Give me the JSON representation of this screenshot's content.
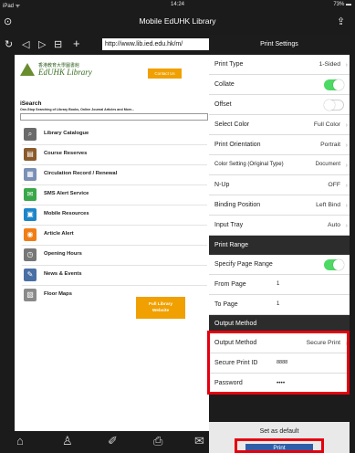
{
  "status": {
    "carrier": "iPad ᯤ",
    "time": "14:24",
    "battery": "73% ▬"
  },
  "window": {
    "title": "Mobile EdUHK Library"
  },
  "browser": {
    "url": "http://www.lib.ied.edu.hk/m/"
  },
  "site": {
    "logo_cn": "香港教育大學圖書館",
    "logo_en": "EdUHK Library",
    "contact_button": "Contact Us",
    "search_title": "iSearch",
    "search_subtitle": "One-Stop Searching of Library Books, Online Journal Articles and More...",
    "menu": [
      {
        "label": "Library Catalogue",
        "icon": "search-icon",
        "color": "#6b6b6b",
        "glyph": "⌕"
      },
      {
        "label": "Course Reserves",
        "icon": "books-icon",
        "color": "#8a5a2b",
        "glyph": "▤"
      },
      {
        "label": "Circulation Record / Renewal",
        "icon": "record-icon",
        "color": "#7a8fb5",
        "glyph": "▦"
      },
      {
        "label": "SMS Alert Service",
        "icon": "sms-icon",
        "color": "#3aa84a",
        "glyph": "✉"
      },
      {
        "label": "Mobile Resources",
        "icon": "mobile-icon",
        "color": "#1d86c8",
        "glyph": "▣"
      },
      {
        "label": "Article Alert",
        "icon": "rss-icon",
        "color": "#f07e16",
        "glyph": "◉"
      },
      {
        "label": "Opening Hours",
        "icon": "clock-icon",
        "color": "#777777",
        "glyph": "◷"
      },
      {
        "label": "News & Events",
        "icon": "news-icon",
        "color": "#4a6fa5",
        "glyph": "✎"
      },
      {
        "label": "Floor Maps",
        "icon": "map-icon",
        "color": "#8a8a8a",
        "glyph": "▧"
      }
    ],
    "full_button_line1": "Full Library",
    "full_button_line2": "Website"
  },
  "print": {
    "title": "Print Settings",
    "rows": [
      {
        "label": "Print Type",
        "value": "1-Sided",
        "chevron": true
      },
      {
        "label": "Collate",
        "toggle": "on"
      },
      {
        "label": "Offset",
        "toggle": "off"
      },
      {
        "label": "Select Color",
        "value": "Full Color",
        "chevron": true
      },
      {
        "label": "Print Orientation",
        "value": "Portrait",
        "chevron": true
      },
      {
        "label": "Color Setting (Original Type)",
        "value": "Document",
        "chevron": true,
        "small": true
      },
      {
        "label": "N-Up",
        "value": "OFF",
        "chevron": true
      },
      {
        "label": "Binding Position",
        "value": "Left Bind",
        "chevron": true
      },
      {
        "label": "Input Tray",
        "value": "Auto",
        "chevron": true
      }
    ],
    "print_range": {
      "header": "Print Range",
      "specify_label": "Specify Page Range",
      "specify_toggle": "on",
      "from_label": "From Page",
      "from_value": "1",
      "to_label": "To Page",
      "to_value": "1"
    },
    "output": {
      "header": "Output Method",
      "method_label": "Output Method",
      "method_value": "Secure Print",
      "id_label": "Secure Print ID",
      "id_value": "8888",
      "password_label": "Password",
      "password_value": "••••"
    },
    "set_default": "Set as default",
    "print_button": "Print"
  },
  "colors": {
    "highlight": "#e5000f",
    "toggle_on": "#4cd964",
    "accent": "#f0a000",
    "print_button": "#2f5ea8"
  }
}
